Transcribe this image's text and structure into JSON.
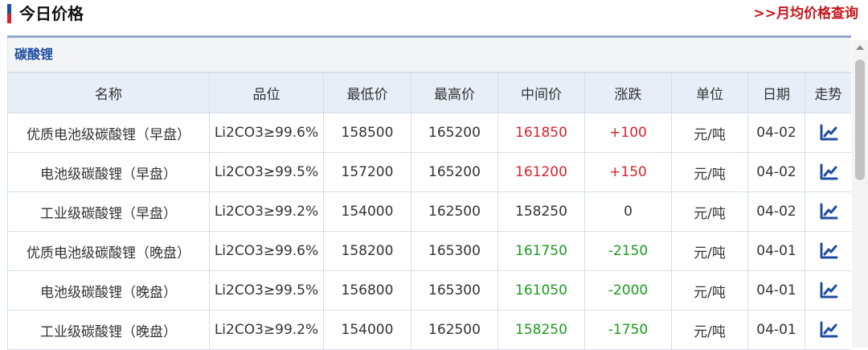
{
  "header": {
    "title": "今日价格",
    "monthly_link": ">>月均价格查询"
  },
  "category": "碳酸锂",
  "columns": [
    "名称",
    "品位",
    "最低价",
    "最高价",
    "中间价",
    "涨跌",
    "单位",
    "日期",
    "走势"
  ],
  "rows": [
    {
      "name": "优质电池级碳酸锂（早盘）",
      "grade": "Li2CO3≥99.6%",
      "low": "158500",
      "high": "165200",
      "mid": "161850",
      "change": "+100",
      "unit": "元/吨",
      "date": "04-02",
      "dir": "up"
    },
    {
      "name": "电池级碳酸锂（早盘）",
      "grade": "Li2CO3≥99.5%",
      "low": "157200",
      "high": "165200",
      "mid": "161200",
      "change": "+150",
      "unit": "元/吨",
      "date": "04-02",
      "dir": "up"
    },
    {
      "name": "工业级碳酸锂（早盘）",
      "grade": "Li2CO3≥99.2%",
      "low": "154000",
      "high": "162500",
      "mid": "158250",
      "change": "0",
      "unit": "元/吨",
      "date": "04-02",
      "dir": "flat"
    },
    {
      "name": "优质电池级碳酸锂（晚盘）",
      "grade": "Li2CO3≥99.6%",
      "low": "158200",
      "high": "165300",
      "mid": "161750",
      "change": "-2150",
      "unit": "元/吨",
      "date": "04-01",
      "dir": "down"
    },
    {
      "name": "电池级碳酸锂（晚盘）",
      "grade": "Li2CO3≥99.5%",
      "low": "156800",
      "high": "165300",
      "mid": "161050",
      "change": "-2000",
      "unit": "元/吨",
      "date": "04-01",
      "dir": "down"
    },
    {
      "name": "工业级碳酸锂（晚盘）",
      "grade": "Li2CO3≥99.2%",
      "low": "154000",
      "high": "162500",
      "mid": "158250",
      "change": "-1750",
      "unit": "元/吨",
      "date": "04-01",
      "dir": "down"
    }
  ],
  "colors": {
    "up": "#d9232d",
    "down": "#1a9b1f",
    "accent_blue": "#1f4da1",
    "accent_red": "#c8161d"
  },
  "icons": {
    "trend": "trend-chart-icon"
  }
}
